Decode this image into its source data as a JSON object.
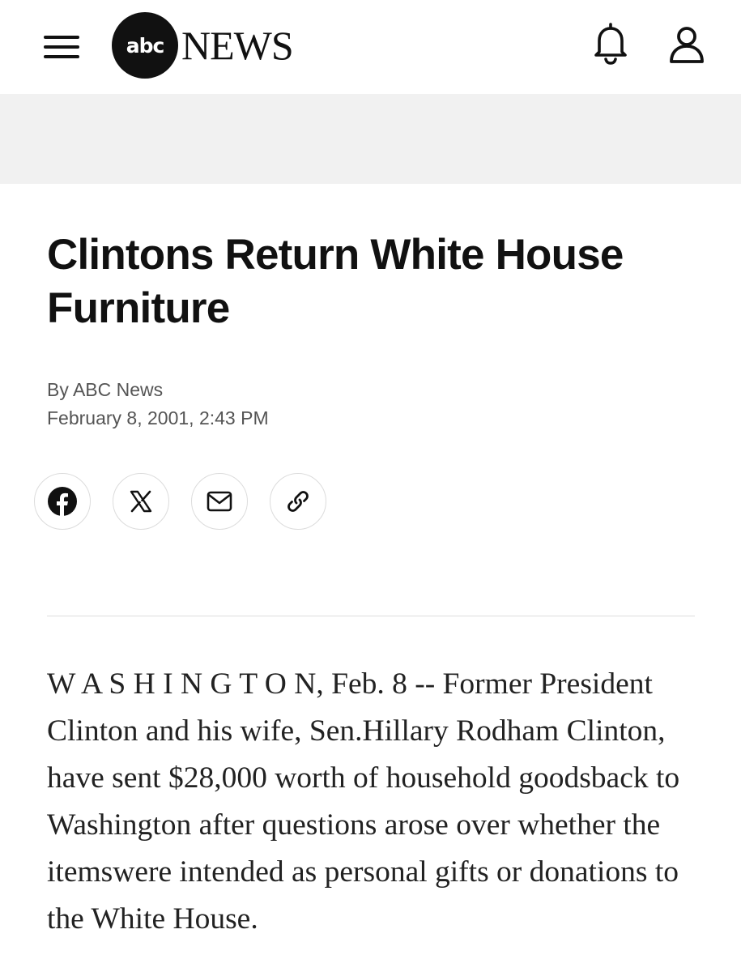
{
  "header": {
    "menu_icon": "hamburger-menu-icon",
    "logo_badge": "abc",
    "logo_word": "NEWS",
    "notification_icon": "bell-icon",
    "account_icon": "user-icon"
  },
  "article": {
    "title": "Clintons Return White House Furniture",
    "byline": "By ABC News",
    "date": "February 8, 2001, 2:43 PM",
    "share_buttons": [
      {
        "icon": "facebook-icon"
      },
      {
        "icon": "x-icon"
      },
      {
        "icon": "email-icon"
      },
      {
        "icon": "link-icon"
      }
    ],
    "body": "W A S H I N G T O N, Feb. 8 -- Former President Clinton and his wife, Sen.Hillary Rodham Clinton, have sent $28,000 worth of household goodsback to Washington after questions arose over whether the itemswere intended as personal gifts or donations to the White House."
  },
  "colors": {
    "text": "#111111",
    "meta": "#555555",
    "ad_band": "#f1f1f1",
    "divider": "#dddddd"
  }
}
